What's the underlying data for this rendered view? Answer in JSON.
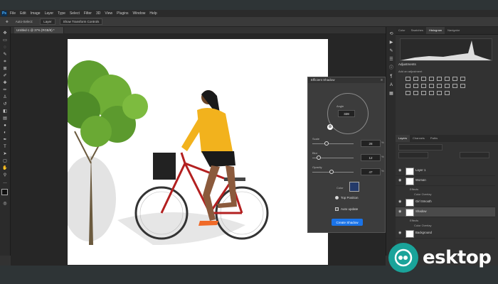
{
  "app": {
    "logo_text": "Ps",
    "menu": [
      "File",
      "Edit",
      "Image",
      "Layer",
      "Type",
      "Select",
      "Filter",
      "3D",
      "View",
      "Plugins",
      "Window",
      "Help"
    ]
  },
  "options_bar": {
    "items": [
      "Auto-Select:",
      "Layer",
      "Show Transform Controls"
    ]
  },
  "document": {
    "tab_label": "Untitled-1 @ 37% (RGB/8) *"
  },
  "shadow_dialog": {
    "title": "Efficient Shadow",
    "angle_label": "Angle",
    "angle_value": "328",
    "sliders": [
      {
        "label": "Scale",
        "value": "28",
        "unit": "%",
        "fill": 0.35
      },
      {
        "label": "Blur",
        "value": "12",
        "unit": "%",
        "fill": 0.15
      },
      {
        "label": "Opacity",
        "value": "47",
        "unit": "%",
        "fill": 0.47
      }
    ],
    "color_label": "Color",
    "color": "#243a6a",
    "radio_label": "Top Position",
    "checkbox_label": "Auto update",
    "create_button": "Create Shadow"
  },
  "panels": {
    "top_tabs": [
      "Color",
      "Swatches",
      "Histogram",
      "Navigator"
    ],
    "adjustments_title": "Adjustments",
    "adjustments_sub": "Add an adjustment",
    "layers_tabs": [
      "Layers",
      "Channels",
      "Paths"
    ],
    "layers": [
      {
        "name": "Layer 1",
        "selected": false
      },
      {
        "name": "Woman",
        "selected": false,
        "effects": [
          "Effects",
          "Color Overlay"
        ]
      },
      {
        "name": "Girl Smooth",
        "selected": false
      },
      {
        "name": "Shadow",
        "selected": true,
        "effects": [
          "Effects",
          "Color Overlay"
        ]
      },
      {
        "name": "Background",
        "selected": false
      }
    ]
  },
  "watermark": {
    "text": "esktop"
  },
  "colors": {
    "accent": "#1a73e8",
    "watermark": "#1aa39a",
    "canvas": "#ffffff"
  }
}
